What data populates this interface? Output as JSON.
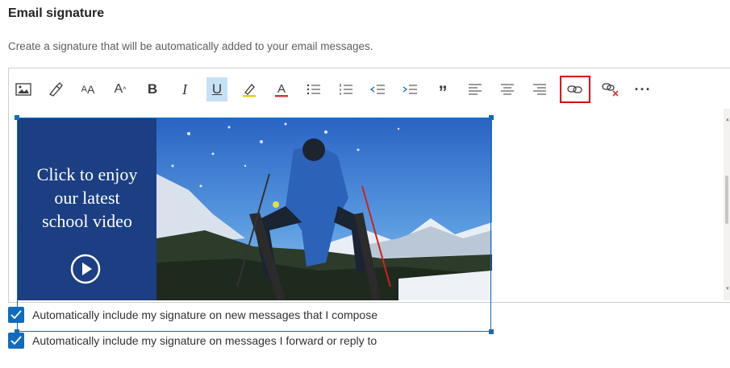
{
  "section": {
    "title": "Email signature",
    "description": "Create a signature that will be automatically added to your email messages."
  },
  "toolbar": {
    "buttons": [
      {
        "name": "insert-picture",
        "glyph": ""
      },
      {
        "name": "format-painter",
        "glyph": ""
      },
      {
        "name": "font-size",
        "glyph": "AA"
      },
      {
        "name": "increase-font",
        "glyph": "A"
      },
      {
        "name": "bold",
        "glyph": "B"
      },
      {
        "name": "italic",
        "glyph": "I"
      },
      {
        "name": "underline",
        "glyph": "U"
      },
      {
        "name": "highlight",
        "glyph": ""
      },
      {
        "name": "font-color",
        "glyph": "A"
      },
      {
        "name": "bullets",
        "glyph": ""
      },
      {
        "name": "numbering",
        "glyph": ""
      },
      {
        "name": "decrease-indent",
        "glyph": ""
      },
      {
        "name": "increase-indent",
        "glyph": ""
      },
      {
        "name": "quote",
        "glyph": "”"
      },
      {
        "name": "align-left",
        "glyph": ""
      },
      {
        "name": "align-center",
        "glyph": ""
      },
      {
        "name": "align-right",
        "glyph": ""
      },
      {
        "name": "insert-link",
        "glyph": ""
      },
      {
        "name": "remove-link",
        "glyph": ""
      },
      {
        "name": "more-options",
        "glyph": "···"
      }
    ],
    "active_button": "underline",
    "highlighted_button": "insert-link"
  },
  "signature_image": {
    "cta_line1": "Click to enjoy",
    "cta_line2": "our latest",
    "cta_line3": "school video",
    "panel_color": "#1b3f82"
  },
  "options": {
    "new_messages": {
      "label": "Automatically include my signature on new messages that I compose",
      "checked": true
    },
    "forward_reply": {
      "label": "Automatically include my signature on messages I forward or reply to",
      "checked": true
    }
  },
  "colors": {
    "accent": "#0f6cbd",
    "highlight_box": "#e00000",
    "active_bg": "#c7e0f4"
  }
}
